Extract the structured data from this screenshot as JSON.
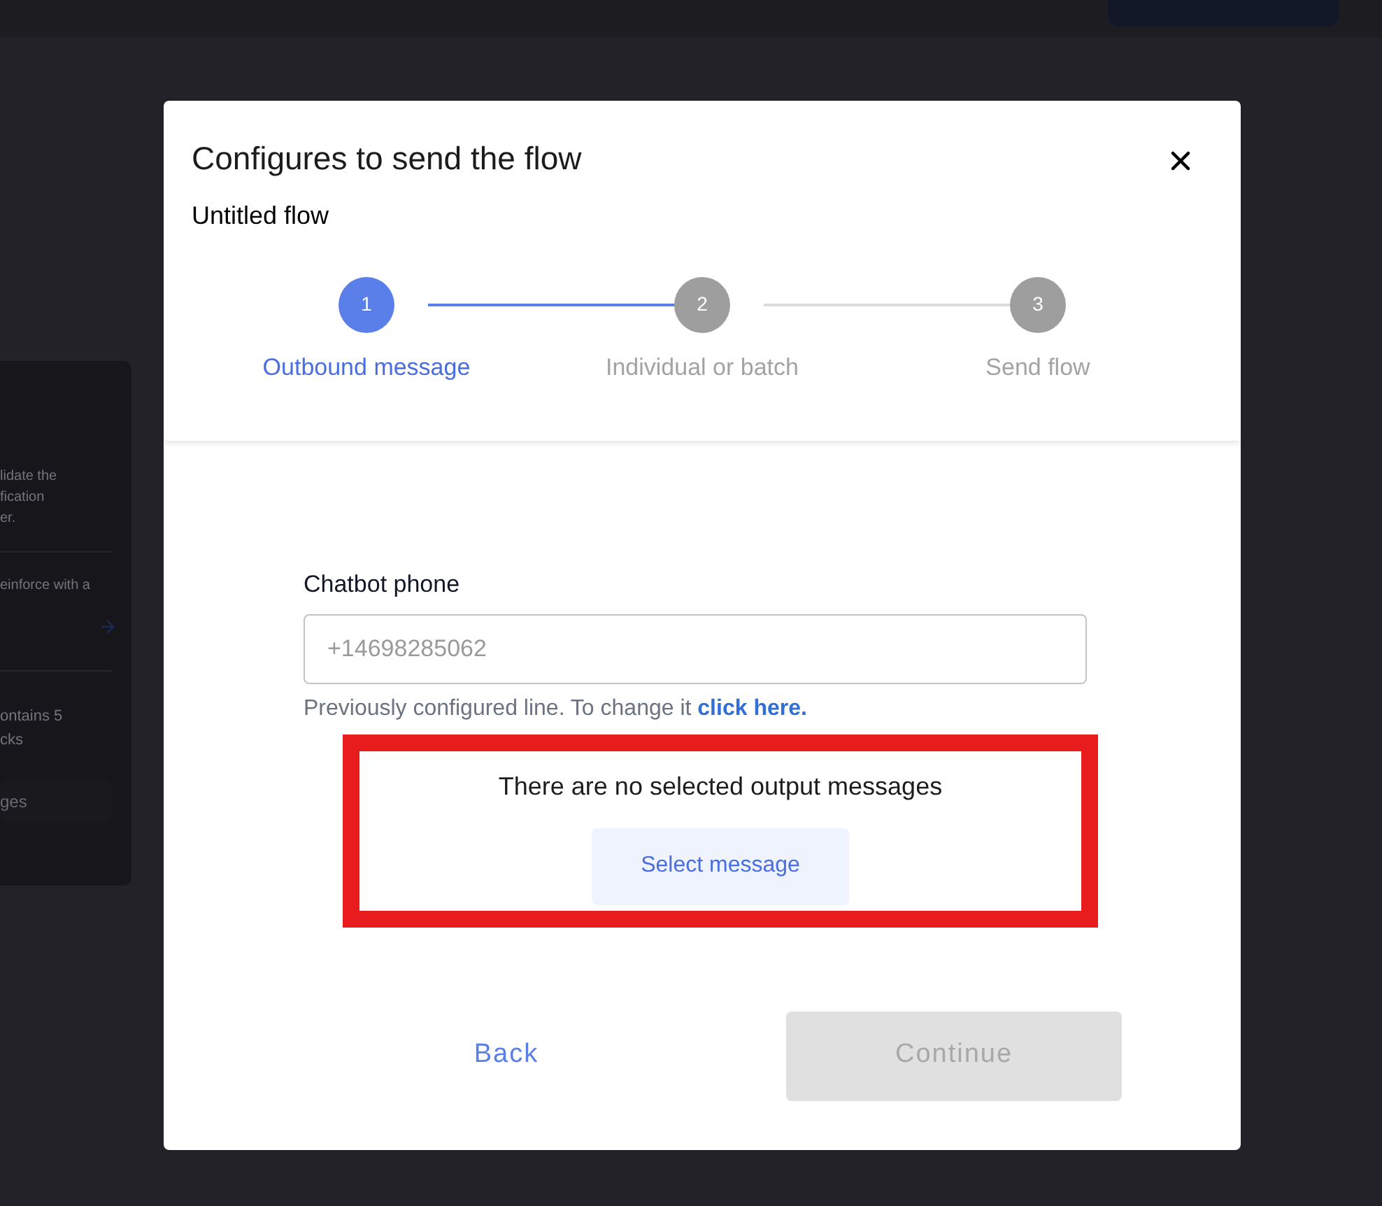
{
  "background_page": {
    "side_panel": {
      "texts": [
        "lidate the",
        "fication",
        "er.",
        "einforce with a",
        "ontains 5",
        "cks"
      ],
      "button": "ges"
    }
  },
  "dialog": {
    "title": "Configures to send the flow",
    "subtitle": "Untitled flow",
    "steps": [
      {
        "number": "1",
        "label": "Outbound message",
        "selected": true
      },
      {
        "number": "2",
        "label": "Individual or batch",
        "selected": false
      },
      {
        "number": "3",
        "label": "Send flow",
        "selected": false
      }
    ],
    "phone_field": {
      "label": "Chatbot phone",
      "value": "+14698285062"
    },
    "help_text": "Previously configured line. To change it ",
    "help_link": "click here.",
    "empty_message": "There are no selected output messages",
    "select_button": "Select message",
    "annotation": {
      "kind": "highlight"
    },
    "buttons": [
      {
        "label": "Back",
        "disabled": false
      },
      {
        "label": "Continue",
        "disabled": true
      }
    ]
  }
}
